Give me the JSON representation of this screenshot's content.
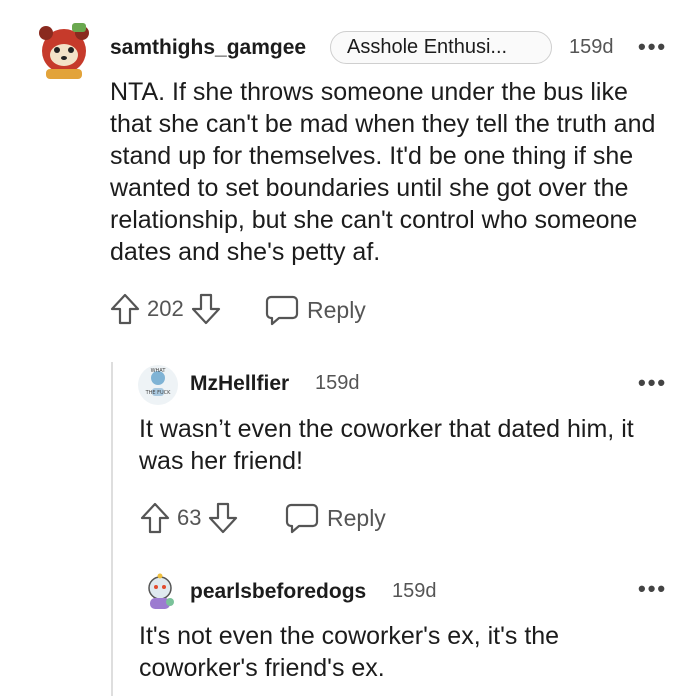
{
  "comments": [
    {
      "username": "samthighs_gamgee",
      "flair": "Asshole Enthusi...",
      "age": "159d",
      "text": "NTA. If she throws someone under the bus like that she can't be mad when they tell the truth and stand up for themselves. It'd be one thing if she wanted to set boundaries until she got over the relationship, but she can't control who someone dates and she's petty af.",
      "score": "202",
      "reply_label": "Reply",
      "avatar_icon": "red-panda-avatar-icon"
    },
    {
      "username": "MzHellfier",
      "age": "159d",
      "text": "It wasn’t even the coworker that dated him, it was her friend!",
      "score": "63",
      "reply_label": "Reply",
      "avatar_icon": "what-the-fuck-avatar-icon",
      "avatar_text": "THE  FUCK"
    },
    {
      "username": "pearlsbeforedogs",
      "age": "159d",
      "text": "It's not even the coworker's ex, it's the coworker's friend's ex.",
      "avatar_icon": "snoo-avatar-icon"
    }
  ],
  "more_label": "•••",
  "colors": {
    "text": "#1c1c1c",
    "meta": "#555555",
    "thread_line": "#dedede",
    "flair_border": "#cfcfcf"
  }
}
